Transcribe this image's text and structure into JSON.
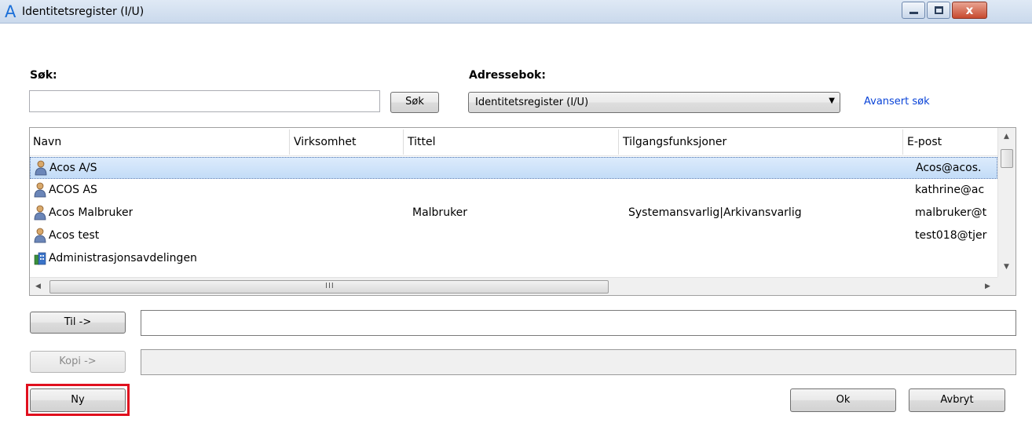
{
  "window": {
    "title": "Identitetsregister (I/U)",
    "app_icon": "A",
    "close_glyph": "x"
  },
  "search": {
    "label": "Søk:",
    "value": "",
    "button_label": "Søk"
  },
  "addressbook": {
    "label": "Adressebok:",
    "selected": "Identitetsregister (I/U)",
    "advanced_link": "Avansert søk"
  },
  "list": {
    "columns": [
      "Navn",
      "Virksomhet",
      "Tittel",
      "Tilgangsfunksjoner",
      "E-post"
    ],
    "rows": [
      {
        "name": "Acos A/S",
        "company": "",
        "title": "",
        "functions": "",
        "email": "Acos@acos.",
        "icon": "person-icon",
        "selected": true
      },
      {
        "name": "ACOS AS",
        "company": "",
        "title": "",
        "functions": "",
        "email": "kathrine@ac",
        "icon": "person-icon",
        "selected": false
      },
      {
        "name": "Acos Malbruker",
        "company": "",
        "title": "Malbruker",
        "functions": "Systemansvarlig|Arkivansvarlig",
        "email": "malbruker@t",
        "icon": "person-icon",
        "selected": false
      },
      {
        "name": "Acos test",
        "company": "",
        "title": "",
        "functions": "",
        "email": "test018@tjer",
        "icon": "person-icon",
        "selected": false
      },
      {
        "name": "Administrasjonsavdelingen",
        "company": "",
        "title": "",
        "functions": "",
        "email": "",
        "icon": "department-icon",
        "selected": false
      }
    ],
    "hscroll_grip": "III"
  },
  "recipients": {
    "to_button": "Til ->",
    "to_value": "",
    "copy_button": "Kopi ->",
    "copy_value": ""
  },
  "footer": {
    "new_button": "Ny",
    "ok_button": "Ok",
    "cancel_button": "Avbryt"
  },
  "colors": {
    "selection": "#c3dcf7",
    "link": "#0a44d8",
    "highlight": "#e0101e"
  }
}
